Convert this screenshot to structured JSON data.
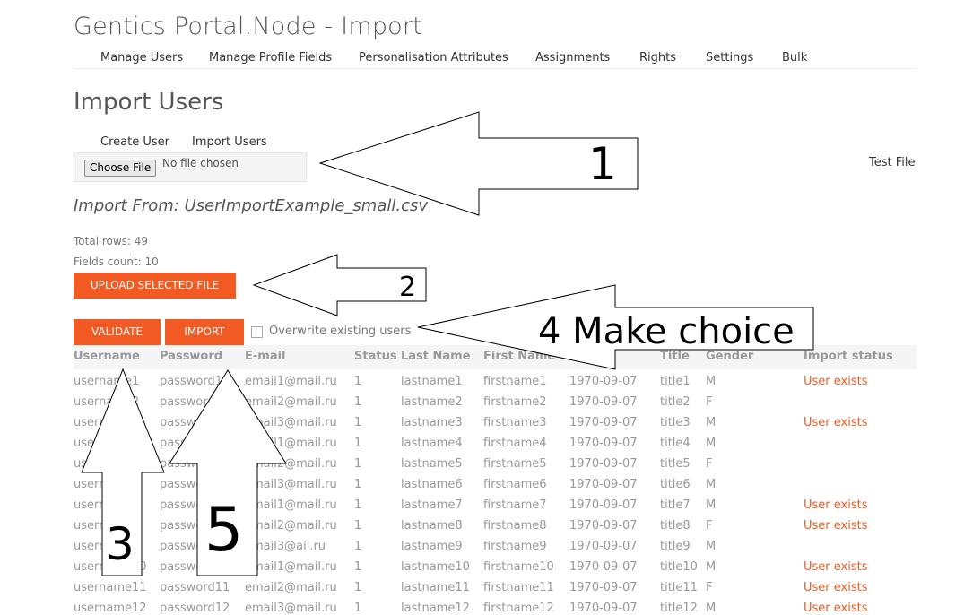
{
  "app": {
    "title": "Gentics Portal.Node - Import"
  },
  "nav": [
    "Manage Users",
    "Manage Profile Fields",
    "Personalisation Attributes",
    "Assignments",
    "Rights",
    "Settings",
    "Bulk"
  ],
  "page": {
    "heading": "Import Users"
  },
  "subnav": [
    "Create User",
    "Import Users"
  ],
  "file": {
    "button": "Choose File",
    "status": "No file chosen",
    "test_link": "Test File"
  },
  "import_from": "Import From: UserImportExample_small.csv",
  "stats": {
    "total_rows": "Total rows: 49",
    "fields_count": "Fields count: 10"
  },
  "actions": {
    "upload": "UPLOAD SELECTED FILE",
    "validate": "VALIDATE",
    "import": "IMPORT",
    "overwrite_label": "Overwrite existing users",
    "overwrite_checked": false
  },
  "table": {
    "columns": [
      "Username",
      "Password",
      "E-mail",
      "Status",
      "Last Name",
      "First Name",
      "",
      "Title",
      "Gender",
      "Import status"
    ],
    "rows": [
      [
        "username1",
        "password1",
        "email1@mail.ru",
        "1",
        "lastname1",
        "firstname1",
        "1970-09-07",
        "title1",
        "M",
        "User exists"
      ],
      [
        "username2",
        "password2",
        "email2@mail.ru",
        "1",
        "lastname2",
        "firstname2",
        "1970-09-07",
        "title2",
        "F",
        ""
      ],
      [
        "username3",
        "password3",
        "email3@mail.ru",
        "1",
        "lastname3",
        "firstname3",
        "1970-09-07",
        "title3",
        "M",
        "User exists"
      ],
      [
        "username4",
        "password4",
        "email1@mail.ru",
        "1",
        "lastname4",
        "firstname4",
        "1970-09-07",
        "title4",
        "M",
        ""
      ],
      [
        "username5",
        "password5",
        "email2@mail.ru",
        "1",
        "lastname5",
        "firstname5",
        "1970-09-07",
        "title5",
        "F",
        ""
      ],
      [
        "username6",
        "password6",
        "email3@mail.ru",
        "1",
        "lastname6",
        "firstname6",
        "1970-09-07",
        "title6",
        "M",
        ""
      ],
      [
        "username7",
        "password7",
        "email1@mail.ru",
        "1",
        "lastname7",
        "firstname7",
        "1970-09-07",
        "title7",
        "M",
        "User exists"
      ],
      [
        "username8",
        "password8",
        "email2@mail.ru",
        "1",
        "lastname8",
        "firstname8",
        "1970-09-07",
        "title8",
        "F",
        "User exists"
      ],
      [
        "username9",
        "password9",
        "email3@ail.ru",
        "1",
        "lastname9",
        "firstname9",
        "1970-09-07",
        "title9",
        "M",
        ""
      ],
      [
        "username10",
        "password10",
        "email1@mail.ru",
        "1",
        "lastname10",
        "firstname10",
        "1970-09-07",
        "title10",
        "M",
        "User exists"
      ],
      [
        "username11",
        "password11",
        "email2@mail.ru",
        "1",
        "lastname11",
        "firstname11",
        "1970-09-07",
        "title11",
        "F",
        "User exists"
      ],
      [
        "username12",
        "password12",
        "email3@mail.ru",
        "1",
        "lastname12",
        "firstname12",
        "1970-09-07",
        "title12",
        "M",
        "User exists"
      ]
    ]
  },
  "annotations": {
    "a1": "1",
    "a2": "2",
    "a3": "3",
    "a4": "4 Make choice",
    "a5": "5"
  },
  "colors": {
    "accent": "#f15a22",
    "muted_text": "#999999"
  }
}
